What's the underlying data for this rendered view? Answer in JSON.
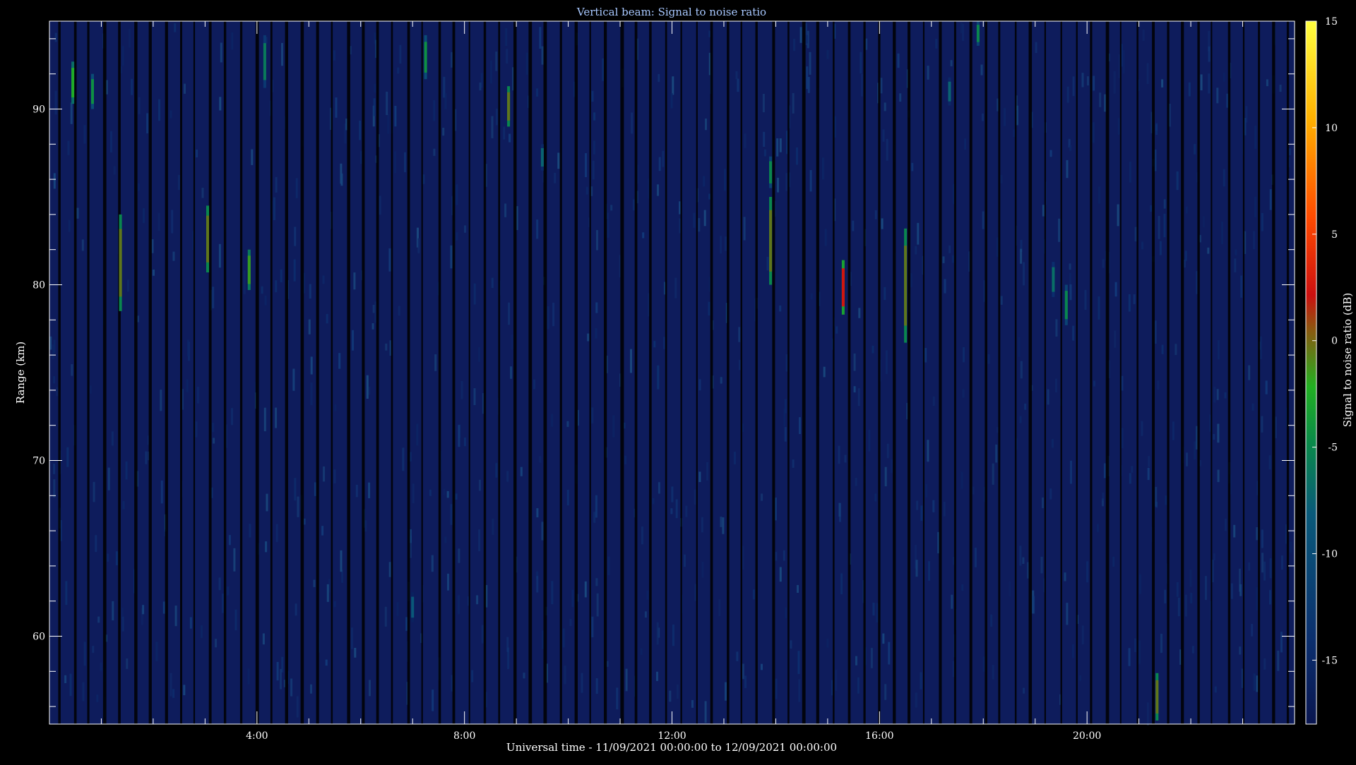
{
  "chart_data": {
    "type": "heatmap",
    "title": "Vertical beam: Signal to noise ratio",
    "xlabel": "Universal time - 11/09/2021 00:00:00 to 12/09/2021 00:00:00",
    "ylabel": "Range (km)",
    "colorbar_label": "Signal to noise ratio (dB)",
    "x_unit": "hours UT",
    "x_range": [
      0,
      24
    ],
    "y_range": [
      55,
      95
    ],
    "c_range": [
      -18,
      15
    ],
    "x_ticks": [
      {
        "value": 4,
        "label": "4:00"
      },
      {
        "value": 8,
        "label": "8:00"
      },
      {
        "value": 12,
        "label": "12:00"
      },
      {
        "value": 16,
        "label": "16:00"
      },
      {
        "value": 20,
        "label": "20:00"
      }
    ],
    "y_ticks": [
      {
        "value": 60,
        "label": "60"
      },
      {
        "value": 70,
        "label": "70"
      },
      {
        "value": 80,
        "label": "80"
      },
      {
        "value": 90,
        "label": "90"
      }
    ],
    "c_ticks": [
      {
        "value": 15,
        "label": "15"
      },
      {
        "value": 10,
        "label": "10"
      },
      {
        "value": 5,
        "label": "5"
      },
      {
        "value": 0,
        "label": "0"
      },
      {
        "value": -5,
        "label": "-5"
      },
      {
        "value": -10,
        "label": "-10"
      },
      {
        "value": -15,
        "label": "-15"
      }
    ],
    "background_snr_db": -16,
    "colorscale": [
      "#0a1650",
      "#0b2f6e",
      "#0a5a7a",
      "#0a8a4a",
      "#22b022",
      "#cc1010",
      "#ff4a00",
      "#ffb000",
      "#ffff40"
    ],
    "echoes": [
      {
        "time": 0.45,
        "range_start": 90.3,
        "range_end": 92.7,
        "snr_db": -2
      },
      {
        "time": 0.83,
        "range_start": 90.0,
        "range_end": 92.0,
        "snr_db": -5
      },
      {
        "time": 1.37,
        "range_start": 78.5,
        "range_end": 84.0,
        "snr_db": 0
      },
      {
        "time": 3.05,
        "range_start": 80.7,
        "range_end": 84.5,
        "snr_db": 0
      },
      {
        "time": 3.85,
        "range_start": 79.7,
        "range_end": 82.0,
        "snr_db": -1
      },
      {
        "time": 4.15,
        "range_start": 91.2,
        "range_end": 94.2,
        "snr_db": -7
      },
      {
        "time": 7.25,
        "range_start": 91.7,
        "range_end": 94.2,
        "snr_db": -5
      },
      {
        "time": 8.85,
        "range_start": 89.0,
        "range_end": 91.3,
        "snr_db": 0
      },
      {
        "time": 13.9,
        "range_start": 85.5,
        "range_end": 87.3,
        "snr_db": -6
      },
      {
        "time": 13.9,
        "range_start": 80.0,
        "range_end": 85.0,
        "snr_db": 0
      },
      {
        "time": 15.3,
        "range_start": 78.3,
        "range_end": 81.4,
        "snr_db": 3
      },
      {
        "time": 16.5,
        "range_start": 76.7,
        "range_end": 83.2,
        "snr_db": 0
      },
      {
        "time": 17.9,
        "range_start": 93.6,
        "range_end": 95.0,
        "snr_db": -6
      },
      {
        "time": 17.35,
        "range_start": 90.2,
        "range_end": 91.8,
        "snr_db": -9
      },
      {
        "time": 19.6,
        "range_start": 77.7,
        "range_end": 80.0,
        "snr_db": -6
      },
      {
        "time": 19.35,
        "range_start": 79.3,
        "range_end": 81.3,
        "snr_db": -8
      },
      {
        "time": 21.35,
        "range_start": 55.2,
        "range_end": 57.9,
        "snr_db": 0
      },
      {
        "time": 7.0,
        "range_start": 60.8,
        "range_end": 62.5,
        "snr_db": -10
      },
      {
        "time": 9.5,
        "range_start": 86.5,
        "range_end": 88.0,
        "snr_db": -9
      }
    ]
  }
}
